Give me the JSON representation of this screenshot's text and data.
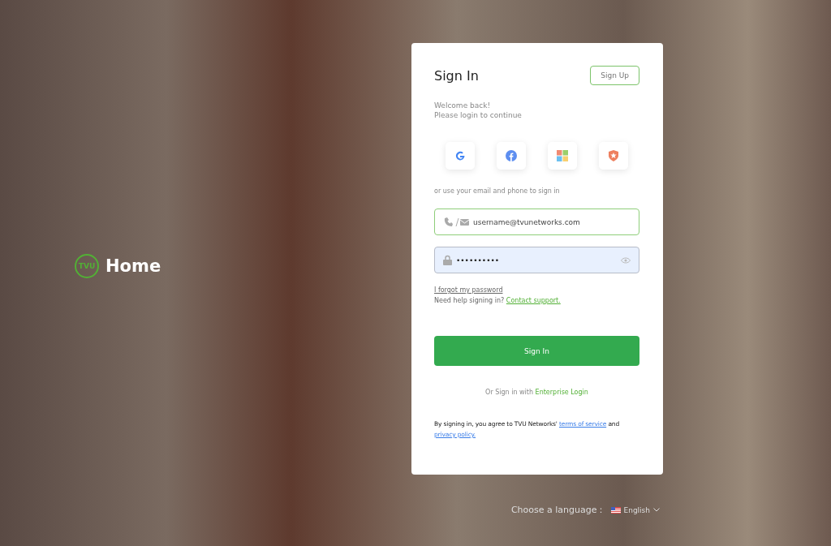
{
  "brand": {
    "logo_text": "TVU",
    "title": "Home"
  },
  "card": {
    "title": "Sign In",
    "signup_button": "Sign Up",
    "welcome": "Welcome back!",
    "subtitle": "Please login to continue",
    "social": [
      {
        "kind": "google"
      },
      {
        "kind": "facebook"
      },
      {
        "kind": "microsoft"
      },
      {
        "kind": "auth0"
      }
    ],
    "divider_text": "or use your email and phone to sign in",
    "username": {
      "value": "username@tvunetworks.com"
    },
    "password": {
      "value": "••••••••••"
    },
    "forgot_link": "I forgot my password",
    "help_text": "Need help signing in?",
    "support_link": "Contact support.",
    "signin_button": "Sign In",
    "enterprise_prefix": "Or Sign in with",
    "enterprise_link": "Enterprise Login",
    "terms_text": "By signing in, you agree to TVU Networks'",
    "terms_link": "terms of service",
    "terms_and": "and",
    "privacy_link": "privacy policy."
  },
  "language": {
    "label": "Choose a language：",
    "value": "English"
  }
}
